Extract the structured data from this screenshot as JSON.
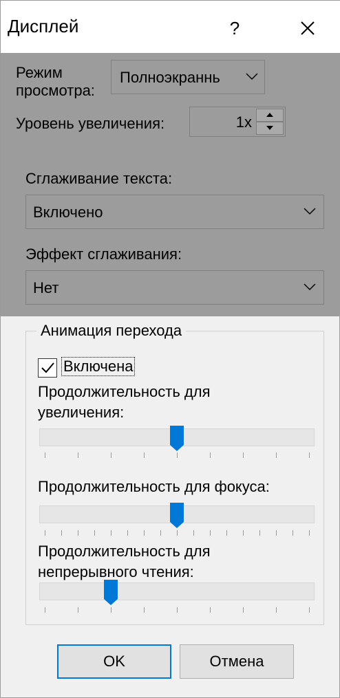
{
  "window": {
    "title": "Дисплей",
    "help": "?"
  },
  "view_mode": {
    "label_line1": "Режим",
    "label_line2": "просмотра:",
    "value": "Полноэкраннь"
  },
  "zoom": {
    "label": "Уровень увеличения:",
    "value": "1x"
  },
  "text_smoothing": {
    "label": "Сглаживание текста:",
    "value": "Включено"
  },
  "smoothing_effect": {
    "label": "Эффект сглаживания:",
    "value": "Нет"
  },
  "animation": {
    "group_title": "Анимация перехода",
    "enabled_label": "Включена",
    "enabled": true,
    "zoom_duration": {
      "label_line1": "Продолжительность для",
      "label_line2": "увеличения:",
      "level": 0.5
    },
    "focus_duration": {
      "label": "Продолжительность для фокуса:",
      "level": 0.5
    },
    "reading_duration": {
      "label_line1": "Продолжительность для",
      "label_line2": "непрерывного чтения:",
      "level": 0.25
    }
  },
  "buttons": {
    "ok": "OK",
    "cancel": "Отмена"
  },
  "colors": {
    "accent": "#0078d7",
    "disabled_bg": "#9c9c9c"
  },
  "icons": [
    "close-icon",
    "chevron-down-icon",
    "spin-up-icon",
    "spin-down-icon",
    "checkmark-icon"
  ]
}
